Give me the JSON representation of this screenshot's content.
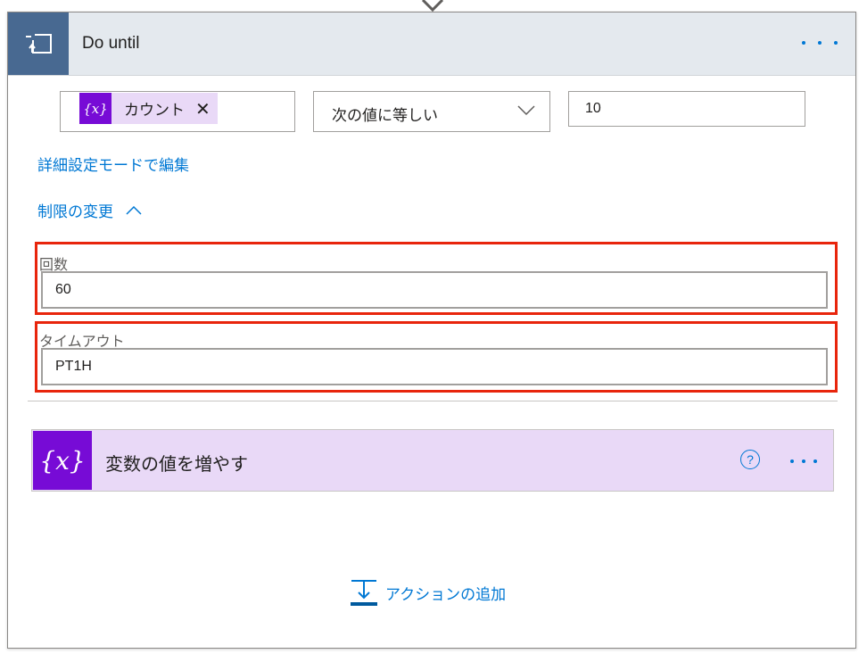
{
  "header": {
    "title": "Do until"
  },
  "condition": {
    "token_label": "カウント",
    "token_icon": "{x}",
    "operator": "次の値に等しい",
    "value": "10"
  },
  "links": {
    "advanced": "詳細設定モードで編集",
    "limits": "制限の変更"
  },
  "limits": {
    "count_label": "回数",
    "count_value": "60",
    "timeout_label": "タイムアウト",
    "timeout_value": "PT1H"
  },
  "action": {
    "title": "変数の値を増やす",
    "icon": "{x}",
    "help": "?"
  },
  "add_action": {
    "label": "アクションの追加"
  },
  "colors": {
    "header_bg": "#e4e9ee",
    "loop_icon_bg": "#486991",
    "variable_purple": "#770bd6",
    "variable_bg": "#e9d9f7",
    "link_blue": "#0078d4",
    "highlight_red": "#e8250c"
  }
}
